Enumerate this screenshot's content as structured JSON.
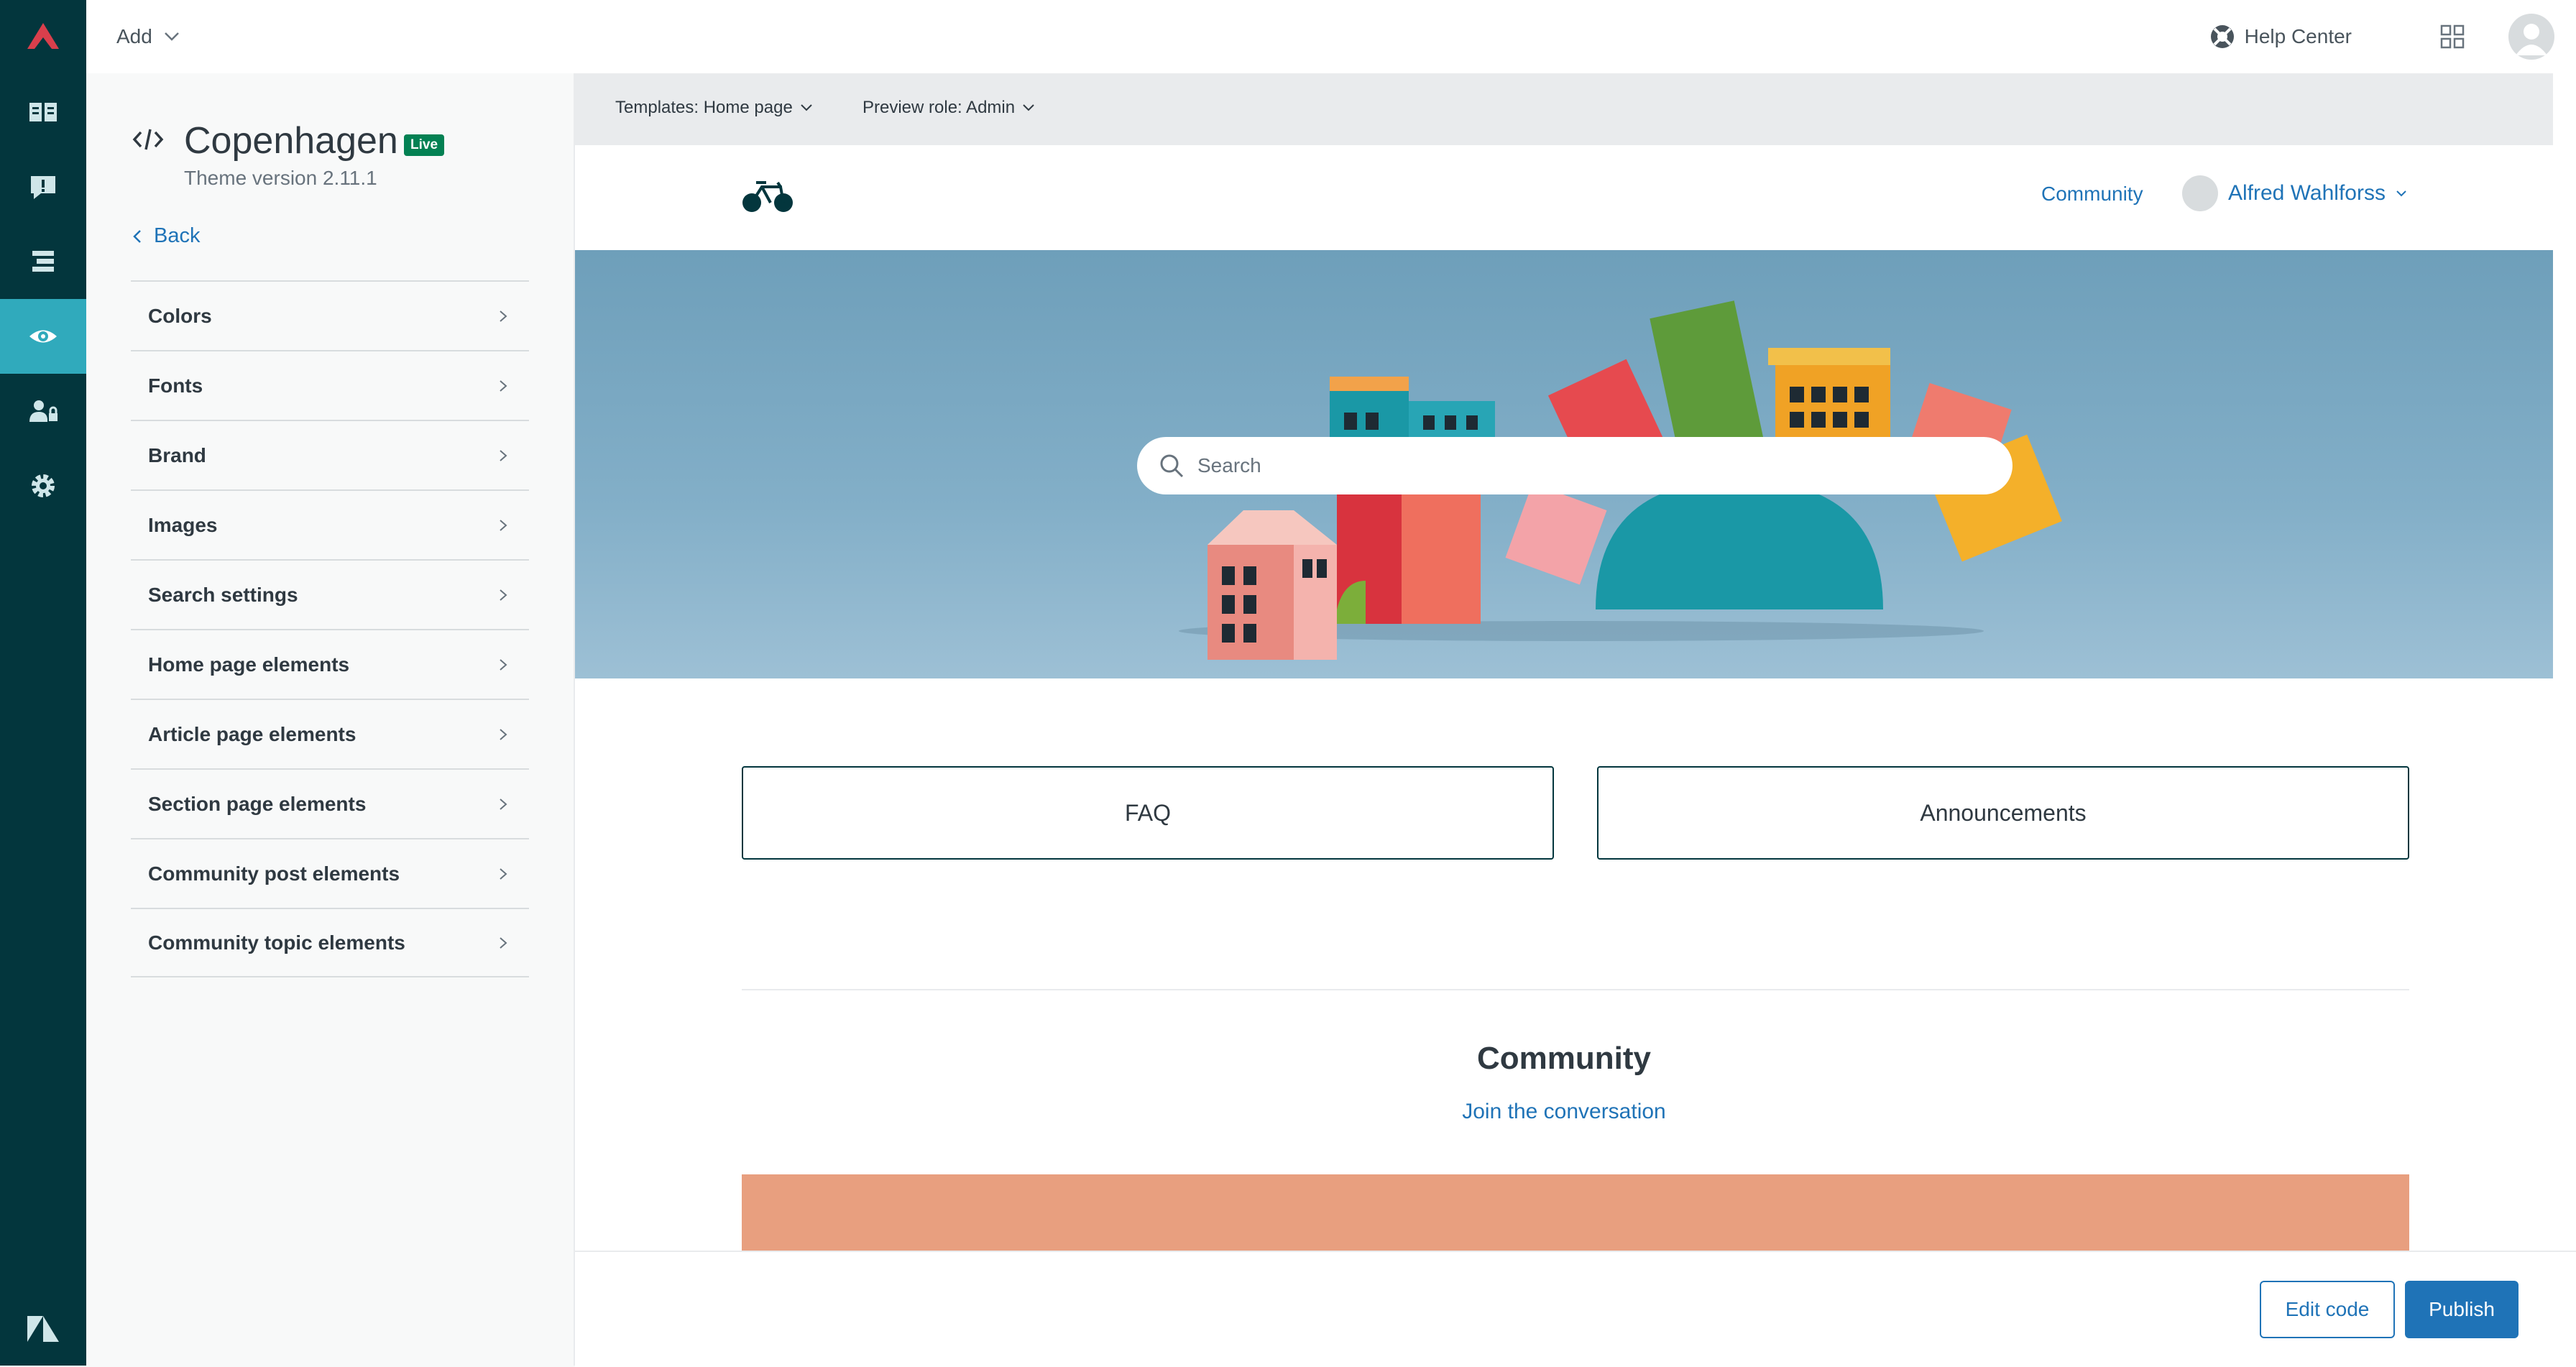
{
  "topbar": {
    "add_label": "Add",
    "help_center_label": "Help Center"
  },
  "theme": {
    "name": "Copenhagen",
    "status_badge": "Live",
    "version": "Theme version 2.11.1",
    "back_label": "Back"
  },
  "settings_menu": [
    {
      "label": "Colors"
    },
    {
      "label": "Fonts"
    },
    {
      "label": "Brand"
    },
    {
      "label": "Images"
    },
    {
      "label": "Search settings"
    },
    {
      "label": "Home page elements"
    },
    {
      "label": "Article page elements"
    },
    {
      "label": "Section page elements"
    },
    {
      "label": "Community post elements"
    },
    {
      "label": "Community topic elements"
    }
  ],
  "preview_bar": {
    "template_select": "Templates: Home page",
    "role_select": "Preview role: Admin"
  },
  "site": {
    "community_link": "Community",
    "user_name": "Alfred Wahlforss",
    "search_placeholder": "Search",
    "blocks": [
      "FAQ",
      "Announcements"
    ],
    "community_title": "Community",
    "community_subtitle": "Join the conversation"
  },
  "footer": {
    "edit_code_label": "Edit code",
    "publish_label": "Publish"
  },
  "colors": {
    "nav_bg": "#03363d",
    "nav_active": "#30aabc",
    "accent_blue": "#1f73b7",
    "live_green": "#038153",
    "community_banner": "#e89f7f"
  },
  "icons": {
    "nav": [
      "zendesk-logo-icon",
      "guide-book-icon",
      "alert-icon",
      "arrange-content-icon",
      "eye-icon",
      "user-permissions-icon",
      "settings-icon",
      "zendesk-z-icon"
    ],
    "topbar": [
      "chevron-down-icon",
      "help-center-icon",
      "apps-grid-icon",
      "avatar"
    ]
  }
}
